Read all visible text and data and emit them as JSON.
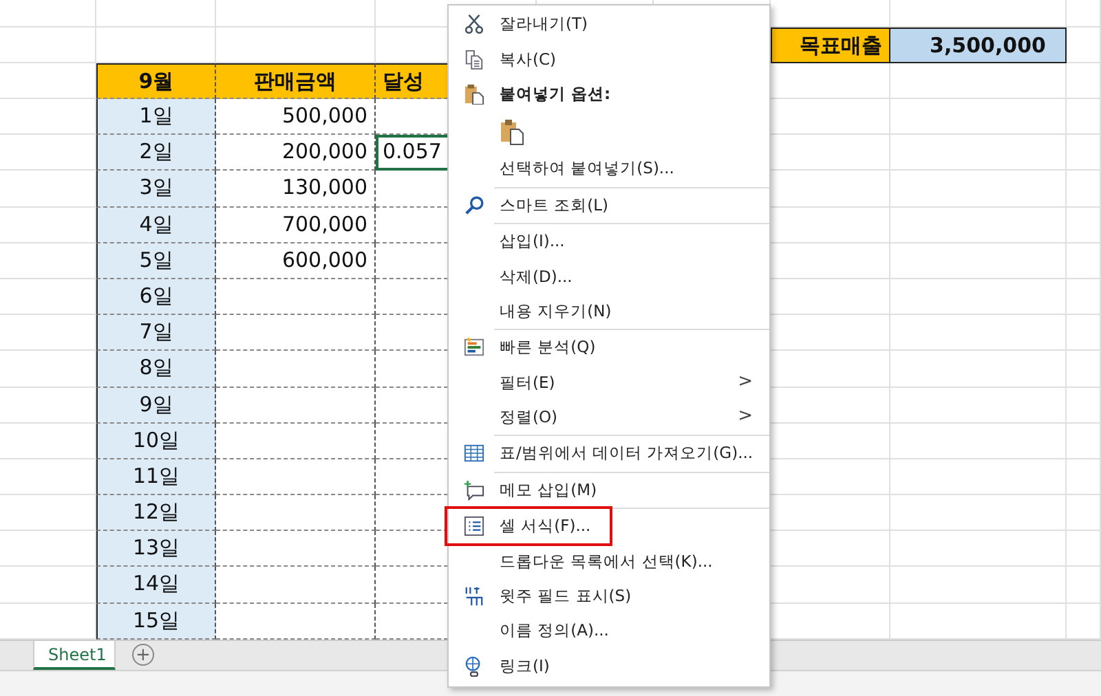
{
  "sheet": {
    "header": [
      "9월",
      "판매금액",
      "달성"
    ],
    "target": {
      "label": "목표매출",
      "value": "3,500,000"
    },
    "rows": [
      {
        "day": "1일",
        "sales": "500,000",
        "cell_selected": false
      },
      {
        "day": "2일",
        "sales": "200,000",
        "rate": "0.057",
        "cell_selected": true
      },
      {
        "day": "3일",
        "sales": "130,000",
        "cell_selected": false
      },
      {
        "day": "4일",
        "sales": "700,000",
        "cell_selected": false
      },
      {
        "day": "5일",
        "sales": "600,000",
        "cell_selected": false
      },
      {
        "day": "6일",
        "cell_selected": false
      },
      {
        "day": "7일",
        "cell_selected": false
      },
      {
        "day": "8일",
        "cell_selected": false
      },
      {
        "day": "9일",
        "cell_selected": false
      },
      {
        "day": "10일",
        "cell_selected": false
      },
      {
        "day": "11일",
        "cell_selected": false
      },
      {
        "day": "12일",
        "cell_selected": false
      },
      {
        "day": "13일",
        "cell_selected": false
      },
      {
        "day": "14일",
        "cell_selected": false
      },
      {
        "day": "15일",
        "cell_selected": false
      }
    ]
  },
  "sheet_tabs": [
    {
      "label": "Sheet1",
      "selected": true
    }
  ],
  "add_sheet": "+",
  "context_menu": [
    {
      "kind": "item",
      "label": "잘라내기(T)",
      "highlighted": false
    },
    {
      "kind": "item",
      "label": "복사(C)",
      "highlighted": false
    },
    {
      "kind": "header",
      "label": "붙여넣기 옵션:"
    },
    {
      "kind": "paste-option"
    },
    {
      "kind": "item",
      "label": "선택하여 붙여넣기(S)...",
      "highlighted": false
    },
    {
      "kind": "separator"
    },
    {
      "kind": "item",
      "label": "스마트 조회(L)",
      "highlighted": false
    },
    {
      "kind": "separator"
    },
    {
      "kind": "item",
      "label": "삽입(I)...",
      "highlighted": false
    },
    {
      "kind": "item",
      "label": "삭제(D)...",
      "highlighted": false
    },
    {
      "kind": "item",
      "label": "내용 지우기(N)",
      "highlighted": false
    },
    {
      "kind": "separator"
    },
    {
      "kind": "item",
      "label": "빠른 분석(Q)",
      "highlighted": false
    },
    {
      "kind": "item",
      "label": "필터(E)",
      "submenu": ">",
      "highlighted": false
    },
    {
      "kind": "item",
      "label": "정렬(O)",
      "submenu": ">",
      "highlighted": false
    },
    {
      "kind": "separator"
    },
    {
      "kind": "item",
      "label": "표/범위에서 데이터 가져오기(G)...",
      "highlighted": false
    },
    {
      "kind": "separator"
    },
    {
      "kind": "item",
      "label": "메모 삽입(M)",
      "highlighted": false
    },
    {
      "kind": "separator"
    },
    {
      "kind": "item",
      "label": "셀 서식(F)...",
      "highlighted": true
    },
    {
      "kind": "item",
      "label": "드롭다운 목록에서 선택(K)...",
      "highlighted": false
    },
    {
      "kind": "item",
      "label": "윗주 필드 표시(S)",
      "highlighted": false
    },
    {
      "kind": "item",
      "label": "이름 정의(A)...",
      "highlighted": false
    },
    {
      "kind": "item",
      "label": "링크(I)",
      "highlighted": false
    }
  ]
}
